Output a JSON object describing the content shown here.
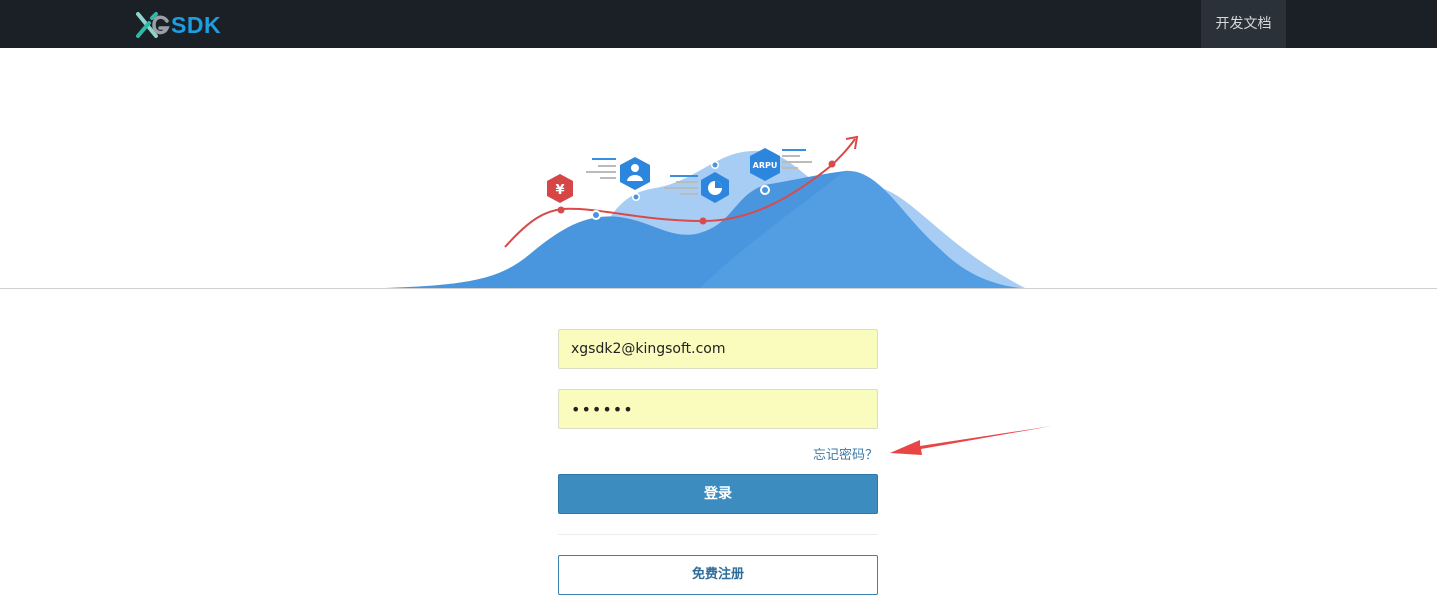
{
  "header": {
    "logo_letters": "SDK",
    "logo_alt": "XGSDK",
    "docs_link": "开发文档"
  },
  "hero": {
    "badges": {
      "revenue_symbol": "¥",
      "arpu_label": "ARPU"
    }
  },
  "login": {
    "email_value": "xgsdk2@kingsoft.com",
    "password_value": "••••••",
    "forgot_link": "忘记密码？",
    "login_button": "登录",
    "register_button": "免费注册"
  },
  "colors": {
    "topbar": "#1b2027",
    "brand": "#1c9ee0",
    "primary_button": "#3d8cbf",
    "autofill": "#fafcbd",
    "annotation_arrow": "#e94545"
  }
}
